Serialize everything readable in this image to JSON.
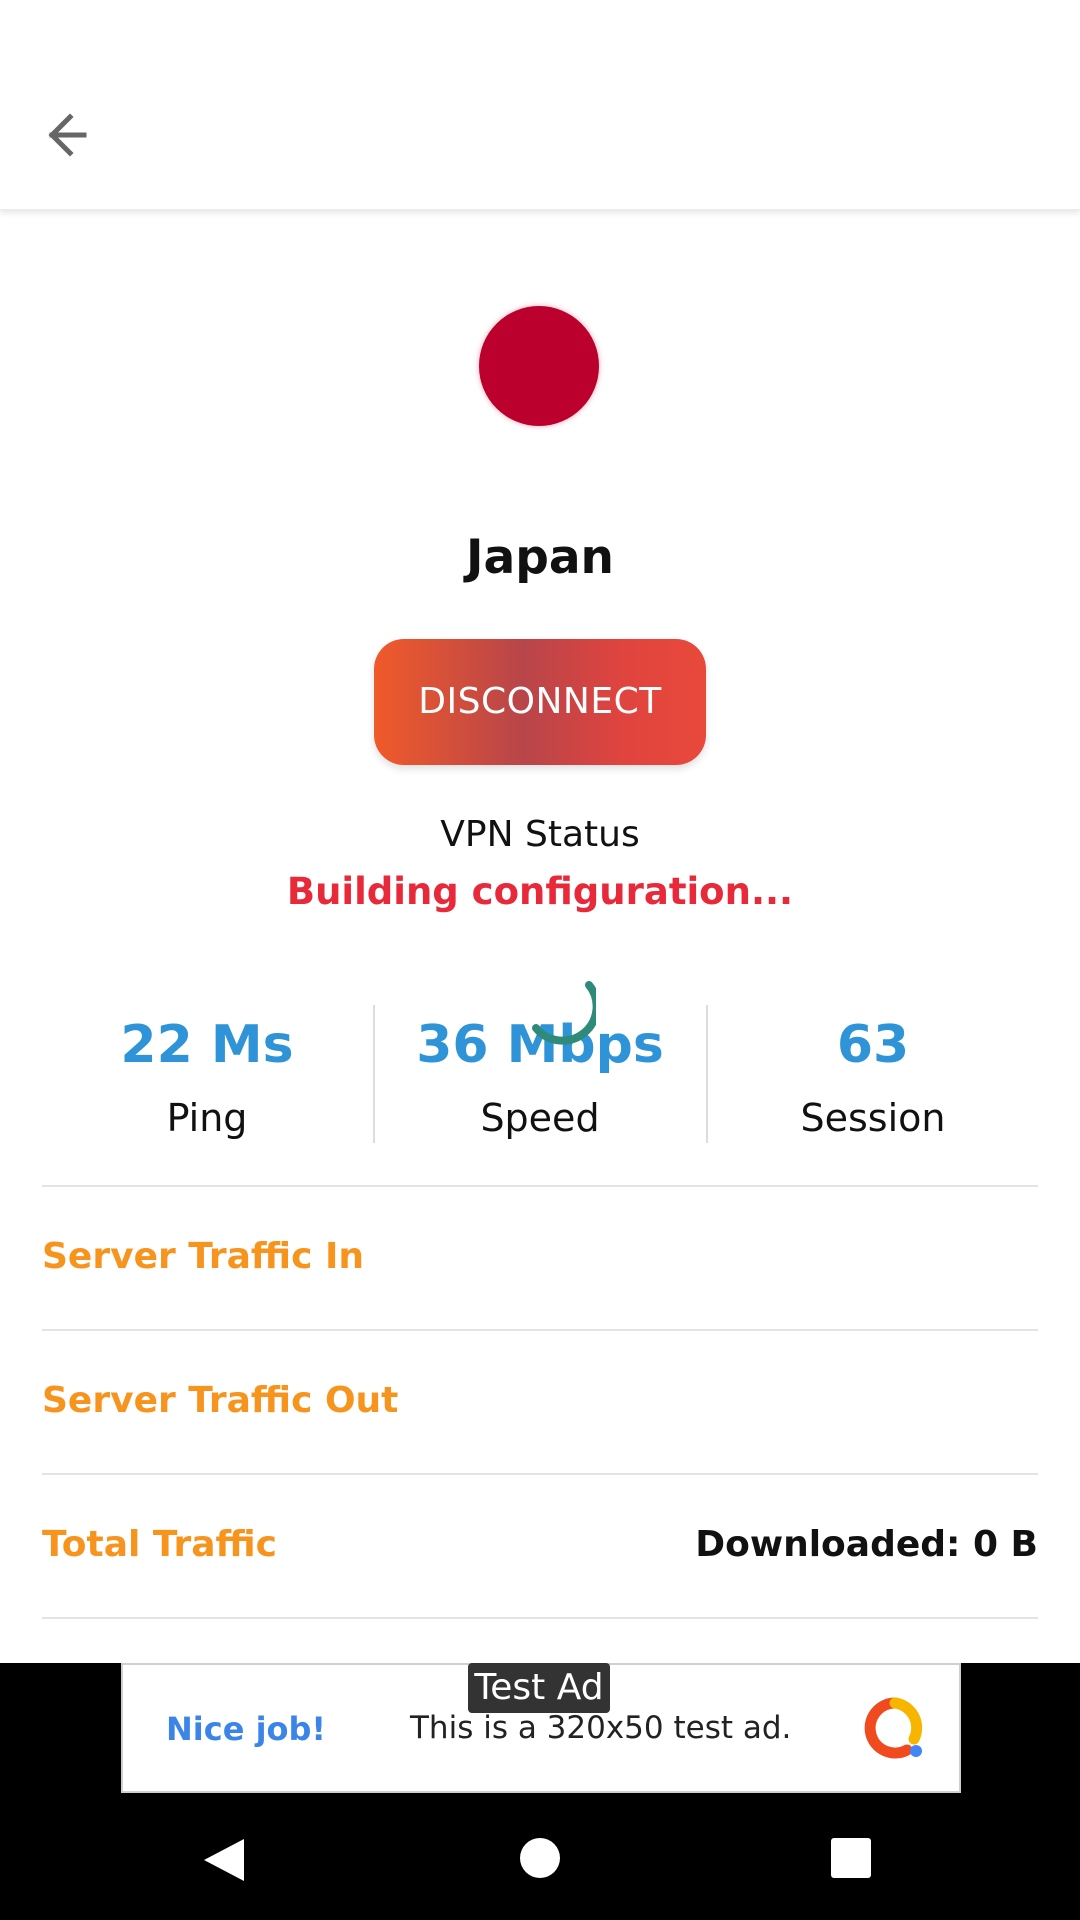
{
  "header": {
    "back_icon": "arrow-left-icon"
  },
  "server": {
    "country": "Japan",
    "flag_icon": "japan-flag-icon",
    "flag_color": "#bc002d"
  },
  "action": {
    "disconnect_label": "DISCONNECT"
  },
  "status": {
    "label": "VPN Status",
    "value": "Building configuration...",
    "value_color": "#e8293a",
    "loading_icon": "spinner-icon"
  },
  "stats": {
    "ping": {
      "value": "22 Ms",
      "label": "Ping"
    },
    "speed": {
      "value": "36 Mbps",
      "label": "Speed"
    },
    "session": {
      "value": "63",
      "label": "Session"
    },
    "value_color": "#2f93d8"
  },
  "traffic": {
    "rows": [
      {
        "label": "Server Traffic In",
        "value": ""
      },
      {
        "label": "Server Traffic Out",
        "value": ""
      },
      {
        "label": "Total Traffic",
        "value": "Downloaded: 0 B"
      }
    ],
    "label_color": "#f7941d"
  },
  "ad": {
    "badge": "Test Ad",
    "headline": "Nice job!",
    "body": "This is a 320x50 test ad.",
    "logo_icon": "ad-logo-icon"
  },
  "system_nav": {
    "back_icon": "nav-back-icon",
    "home_icon": "nav-home-icon",
    "recents_icon": "nav-recents-icon"
  }
}
